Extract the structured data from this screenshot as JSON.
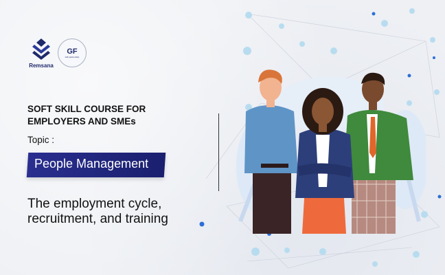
{
  "logos": {
    "remsana_label": "Remsana",
    "gf_main": "GF",
    "gf_sub": "GiZ partnership"
  },
  "course": {
    "title_line1": "SOFT SKILL COURSE FOR",
    "title_line2": "EMPLOYERS AND SMEs",
    "topic_label": "Topic :",
    "topic_banner": "People Management",
    "subtitle_line1": "The employment cycle,",
    "subtitle_line2": "recruitment, and training"
  },
  "colors": {
    "brand_navy": "#1f2a6b",
    "banner": "#2a2f8f",
    "background": "#eef0f4"
  },
  "illustration": "three-professionals-illustration"
}
